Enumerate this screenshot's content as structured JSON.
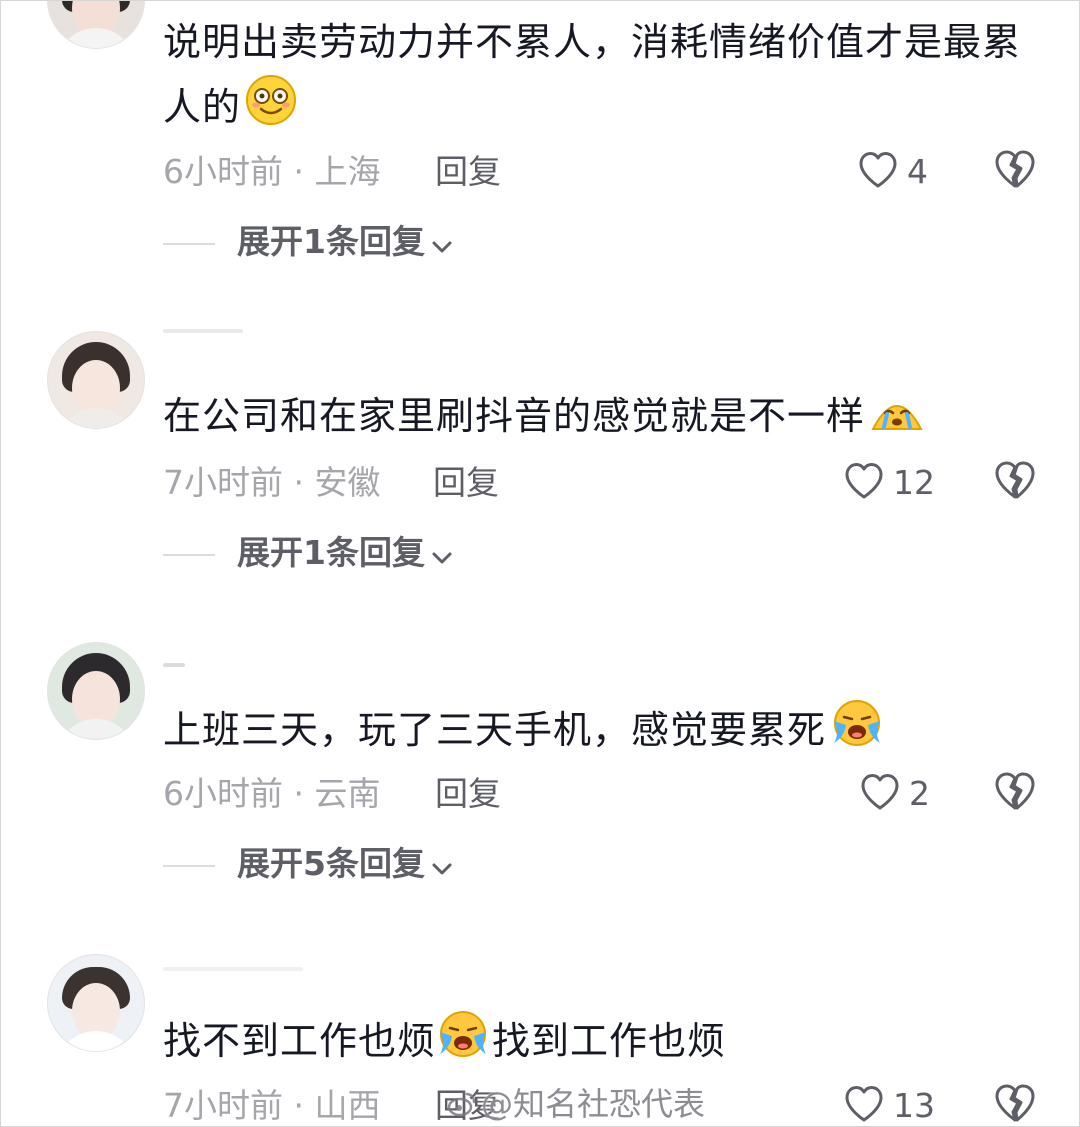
{
  "comments": [
    {
      "text": "说明出卖劳动力并不累人，消耗情绪价值才是最累人的",
      "emoji": "smiling-face-emoji",
      "time_location": "6小时前 · 上海",
      "reply_label": "回复",
      "likes": "4",
      "expand_label": "展开1条回复"
    },
    {
      "text": "在公司和在家里刷抖音的感觉就是不一样",
      "emoji": "crying-face-emoji",
      "time_location": "7小时前 · 安徽",
      "reply_label": "回复",
      "likes": "12",
      "expand_label": "展开1条回复"
    },
    {
      "text": "上班三天，玩了三天手机，感觉要累死",
      "emoji": "loudly-crying-face-emoji",
      "time_location": "6小时前 · 云南",
      "reply_label": "回复",
      "likes": "2",
      "expand_label": "展开5条回复"
    },
    {
      "text_part1": "找不到工作也烦",
      "text_part2": "找到工作也烦",
      "emoji": "loudly-crying-face-emoji",
      "time_location": "7小时前 · 山西",
      "reply_label": "回复",
      "likes": "13"
    }
  ],
  "watermark": {
    "text": "@知名社恐代表"
  },
  "icons": {
    "like": "heart-outline-icon",
    "dislike": "broken-heart-icon",
    "expand": "chevron-down-icon"
  },
  "colors": {
    "primary_text": "#161823",
    "secondary_text": "#a5a6ab",
    "action_text": "#5e5f66",
    "background": "#ffffff"
  }
}
